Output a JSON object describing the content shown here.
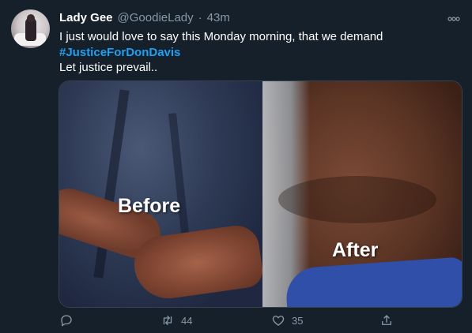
{
  "tweet": {
    "name": "Lady Gee",
    "handle": "@GoodieLady",
    "separator": "·",
    "time": "43m",
    "text_line1": "I just would love to say this Monday morning, that we demand",
    "hashtag": "#JusticeForDonDavis",
    "text_line3": "Let justice prevail..",
    "media": {
      "left_label": "Before",
      "right_label": "After"
    },
    "actions": {
      "reply_count": "",
      "retweet_count": "44",
      "like_count": "35"
    }
  },
  "colors": {
    "background": "#15202b",
    "accent": "#1da1f2",
    "secondary_text": "#8899a6"
  },
  "icons": [
    "more-icon",
    "reply-icon",
    "retweet-icon",
    "like-icon",
    "share-icon"
  ]
}
